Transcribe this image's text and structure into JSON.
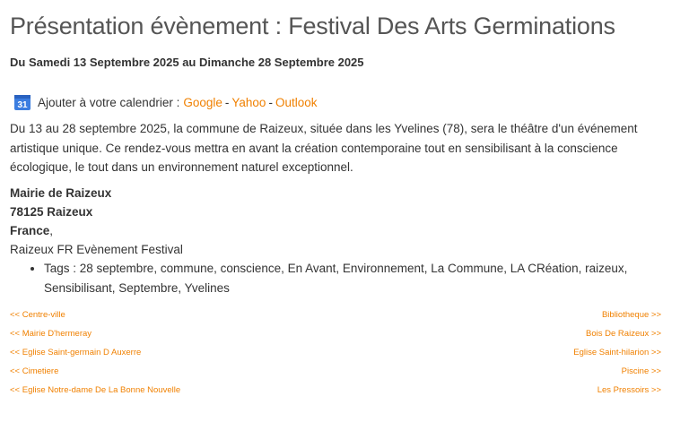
{
  "event": {
    "title": "Présentation évènement : Festival Des Arts Germinations",
    "dates": "Du Samedi 13 Septembre 2025 au Dimanche 28 Septembre 2025"
  },
  "calendar": {
    "icon_day": "31",
    "label": "Ajouter à votre calendrier :",
    "links": [
      "Google",
      "Yahoo",
      "Outlook"
    ],
    "separator": "-"
  },
  "description": "Du 13 au 28 septembre 2025, la commune de Raizeux, située dans les Yvelines (78), sera le théâtre d'un événement artistique unique. Ce rendez-vous mettra en avant la création contemporaine tout en sensibilisant à la conscience écologique, le tout dans un environnement naturel exceptionnel.",
  "address": {
    "name": "Mairie de Raizeux",
    "city": "78125 Raizeux",
    "country": "France",
    "country_suffix": ",",
    "meta": "Raizeux FR Evènement Festival"
  },
  "tags": "Tags : 28 septembre, commune, conscience, En Avant, Environnement, La Commune, LA CRéation, raizeux, Sensibilisant, Septembre, Yvelines",
  "navigation": {
    "left": [
      "<< Centre-ville",
      "<< Mairie D'hermeray",
      "<< Eglise Saint-germain D Auxerre",
      "<< Cimetiere",
      "<< Eglise Notre-dame De La Bonne Nouvelle"
    ],
    "right": [
      "Bibliotheque >>",
      "Bois De Raizeux >>",
      "Eglise Saint-hilarion >>",
      "Piscine >>",
      "Les Pressoirs >>"
    ]
  },
  "colors": {
    "link": "#f08000",
    "calendar_icon": "#3b7de0"
  }
}
